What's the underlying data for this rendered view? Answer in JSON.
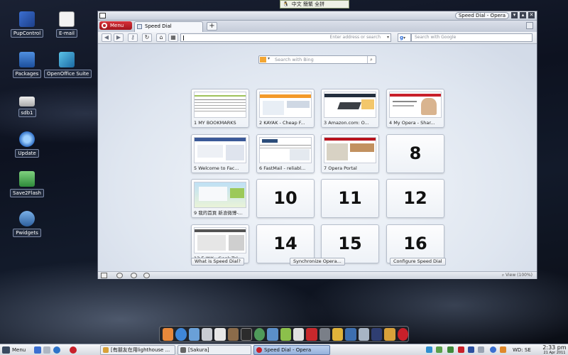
{
  "desktop": {
    "icons": [
      {
        "label": "PupControl"
      },
      {
        "label": "E-mail"
      },
      {
        "label": "Packages"
      },
      {
        "label": "OpenOffice Suite"
      },
      {
        "label": "sdb1"
      },
      {
        "label": "Update"
      },
      {
        "label": "Save2Flash"
      },
      {
        "label": "Pwidgets"
      }
    ],
    "top_tray_text": "中文 簡繁 全拼"
  },
  "window": {
    "title": "Speed Dial - Opera",
    "menu_label": "Menu",
    "tab_label": "Speed Dial",
    "new_tab_label": "+",
    "address_placeholder": "Enter address or search",
    "search_engine": "g",
    "search_placeholder": "Search with Google"
  },
  "speed_dial": {
    "bing_placeholder": "Search with Bing",
    "dials": [
      {
        "caption": "1    MY BOOKMARKS",
        "number": ""
      },
      {
        "caption": "2 KAYAK - Cheap F...",
        "number": ""
      },
      {
        "caption": "3 Amazon.com: O...",
        "number": ""
      },
      {
        "caption": "4 My Opera - Shar...",
        "number": ""
      },
      {
        "caption": "5 Welcome to Fac...",
        "number": ""
      },
      {
        "caption": "6 FastMail - reliabl...",
        "number": ""
      },
      {
        "caption": "7      Opera Portal",
        "number": ""
      },
      {
        "caption": "",
        "number": "8"
      },
      {
        "caption": "9 我的首頁 新浪微博-...",
        "number": ""
      },
      {
        "caption": "",
        "number": "10"
      },
      {
        "caption": "",
        "number": "11"
      },
      {
        "caption": "",
        "number": "12"
      },
      {
        "caption": "13 E-INK - Geek Tal...",
        "number": ""
      },
      {
        "caption": "",
        "number": "14"
      },
      {
        "caption": "",
        "number": "15"
      },
      {
        "caption": "",
        "number": "16"
      }
    ],
    "what_is_label": "What is Speed Dial?",
    "sync_label": "Synchronize Opera...",
    "configure_label": "Configure Speed Dial",
    "zoom_label": "View (100%)"
  },
  "taskbar": {
    "menu_label": "Menu",
    "tasks": [
      {
        "label": "[有朋友在用lighthouse ..."
      },
      {
        "label": "[Sakura]"
      },
      {
        "label": "Speed Dial - Opera"
      }
    ],
    "keyboard_label": "WD: SE",
    "time": "2:33 pm",
    "date": "21 Apr 2011"
  },
  "colors": {
    "opera_red": "#c8202a",
    "active_task": "#95b1dc",
    "desktop_bg": "#0d1220"
  }
}
